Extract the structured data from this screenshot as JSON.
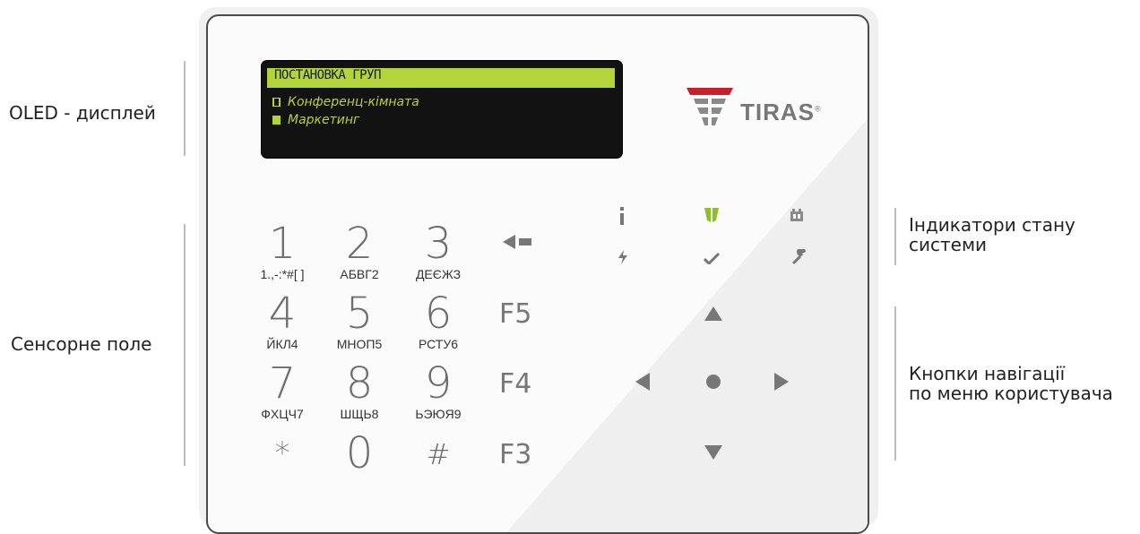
{
  "labels": {
    "oled": "OLED - дисплей",
    "touch": "Сенсорне поле",
    "indicators": "Індикатори стану\nсистеми",
    "navigation": "Кнопки навігації\nпо меню користувача"
  },
  "display": {
    "title": "ПОСТАНОВКА ГРУП",
    "items": [
      {
        "label": "Конференц-кімната",
        "checked": false
      },
      {
        "label": "Маркетинг",
        "checked": true
      }
    ]
  },
  "brand": {
    "name": "TIRAS",
    "mark": "®",
    "accent": "#c8202a",
    "display_accent": "#b3d43a"
  },
  "keypad": [
    {
      "digit": "1",
      "sub": "1.,-:*#[ ]"
    },
    {
      "digit": "2",
      "sub": "АБВГ2"
    },
    {
      "digit": "3",
      "sub": "ДЕЄЖЗ"
    },
    {
      "digit": "4",
      "sub": "ЙКЛ4"
    },
    {
      "digit": "5",
      "sub": "МНОП5"
    },
    {
      "digit": "6",
      "sub": "РСТУ6"
    },
    {
      "digit": "7",
      "sub": "ФХЦЧ7"
    },
    {
      "digit": "8",
      "sub": "ШЩЬ8"
    },
    {
      "digit": "9",
      "sub": "ЬЭЮЯ9"
    },
    {
      "digit": "*",
      "sub": ""
    },
    {
      "digit": "0",
      "sub": ""
    },
    {
      "digit": "#",
      "sub": ""
    }
  ],
  "function_keys": {
    "f5": "F5",
    "f4": "F4",
    "f3": "F3",
    "backspace": "back-arrow-icon"
  },
  "indicators": [
    "info-icon",
    "shield-icon",
    "battery-icon",
    "power-icon",
    "check-icon",
    "wrench-icon"
  ],
  "navigation": [
    "up-arrow-icon",
    "left-arrow-icon",
    "ok-dot-icon",
    "right-arrow-icon",
    "down-arrow-icon"
  ]
}
